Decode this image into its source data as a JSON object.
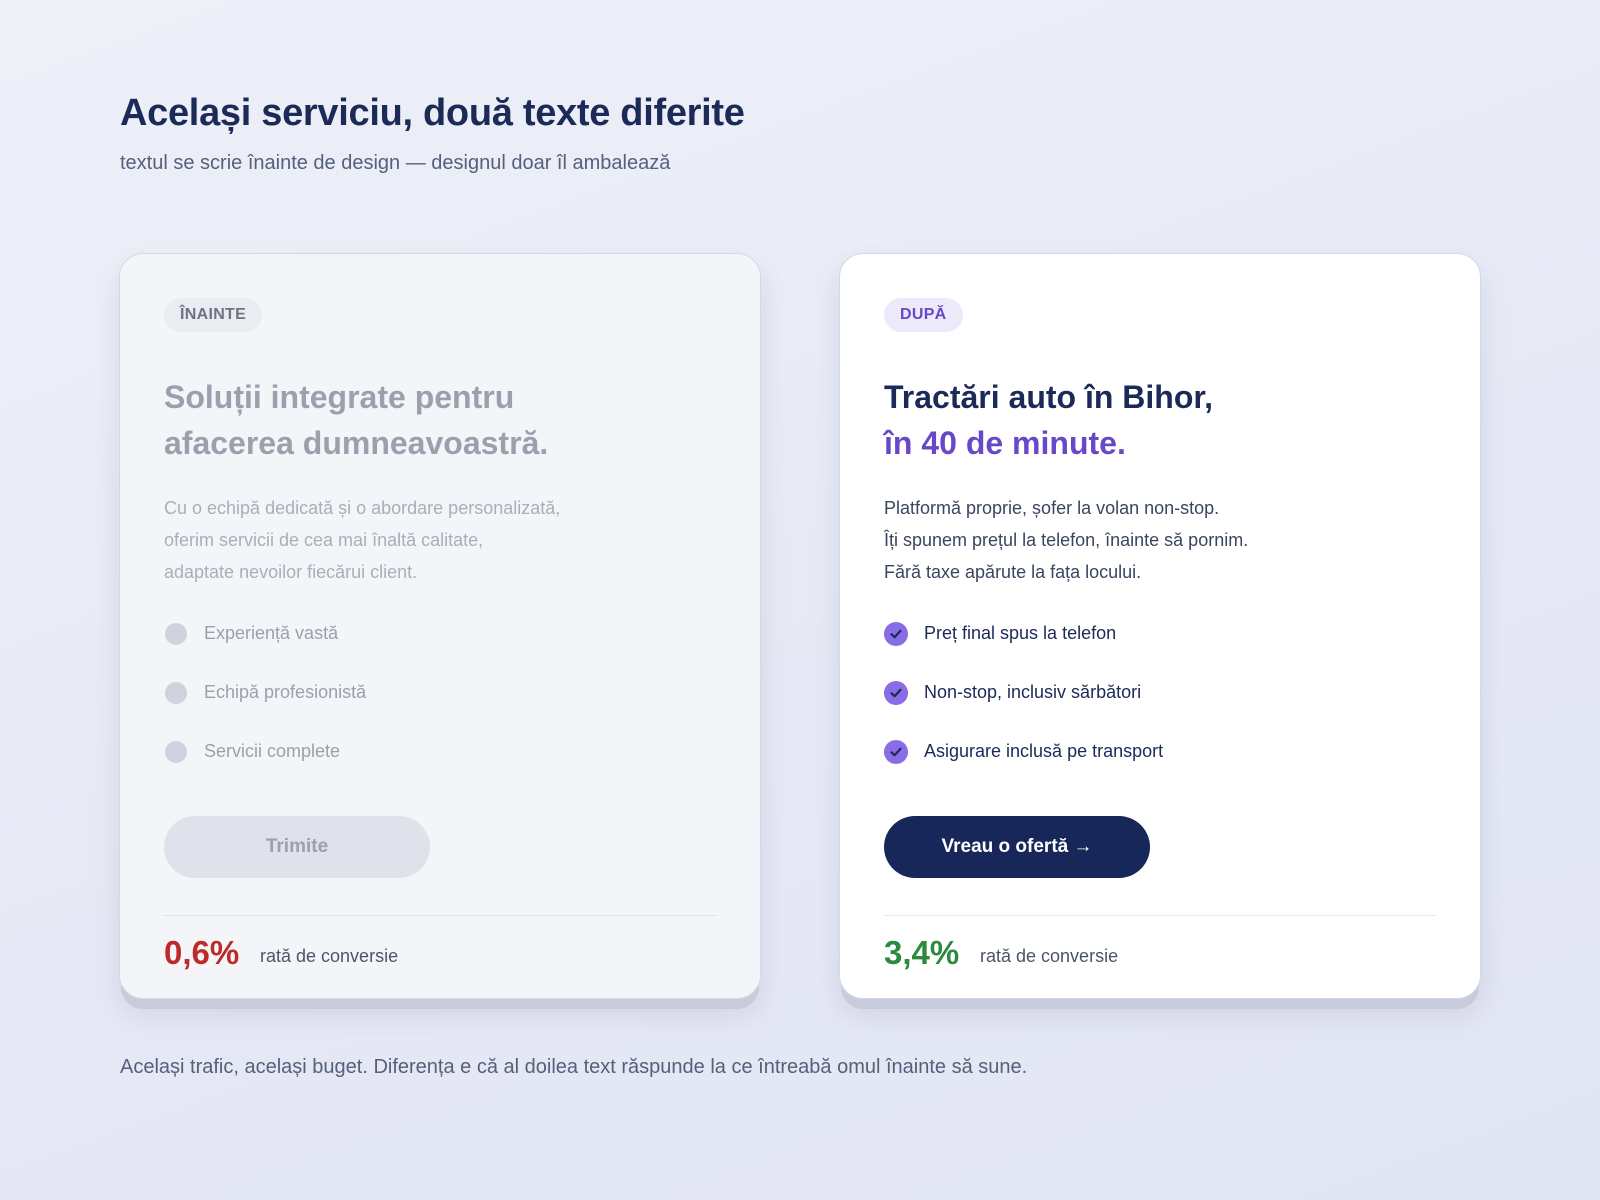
{
  "header": {
    "title": "Același serviciu, două texte diferite",
    "subtitle": "textul se scrie înainte de design — designul doar îl ambalează"
  },
  "before": {
    "tag": "ÎNAINTE",
    "headline_line1": "Soluții integrate pentru",
    "headline_line2": "afacerea dumneavoastră.",
    "body_lines": [
      "Cu o echipă dedicată și o abordare personalizată,",
      "oferim servicii de cea mai înaltă calitate,",
      "adaptate nevoilor fiecărui client."
    ],
    "features": [
      "Experiență vastă",
      "Echipă profesionistă",
      "Servicii complete"
    ],
    "button_label": "Trimite",
    "stat_value": "0,6%",
    "stat_label": "rată de conversie"
  },
  "after": {
    "tag": "DUPĂ",
    "headline_line1": "Tractări auto în Bihor,",
    "headline_line2": "în 40 de minute.",
    "body_lines": [
      "Platformă proprie, șofer la volan non-stop.",
      "Îți spunem prețul la telefon, înainte să pornim.",
      "Fără taxe apărute la fața locului."
    ],
    "features": [
      "Preț final spus la telefon",
      "Non-stop, inclusiv sărbători",
      "Asigurare inclusă pe transport"
    ],
    "button_label": "Vreau o ofertă →",
    "stat_value": "3,4%",
    "stat_label": "rată de conversie"
  },
  "footnote": "Același trafic, același buget. Diferența e că al doilea text răspunde la ce întreabă omul înainte să sune.",
  "colors": {
    "navy": "#1b2a57",
    "accent_purple": "#6848c8",
    "bad_red": "#be2a2a",
    "good_green": "#2b8a3e"
  },
  "icons": {
    "before_feature": "grey-dot-icon",
    "after_feature": "purple-check-icon"
  }
}
